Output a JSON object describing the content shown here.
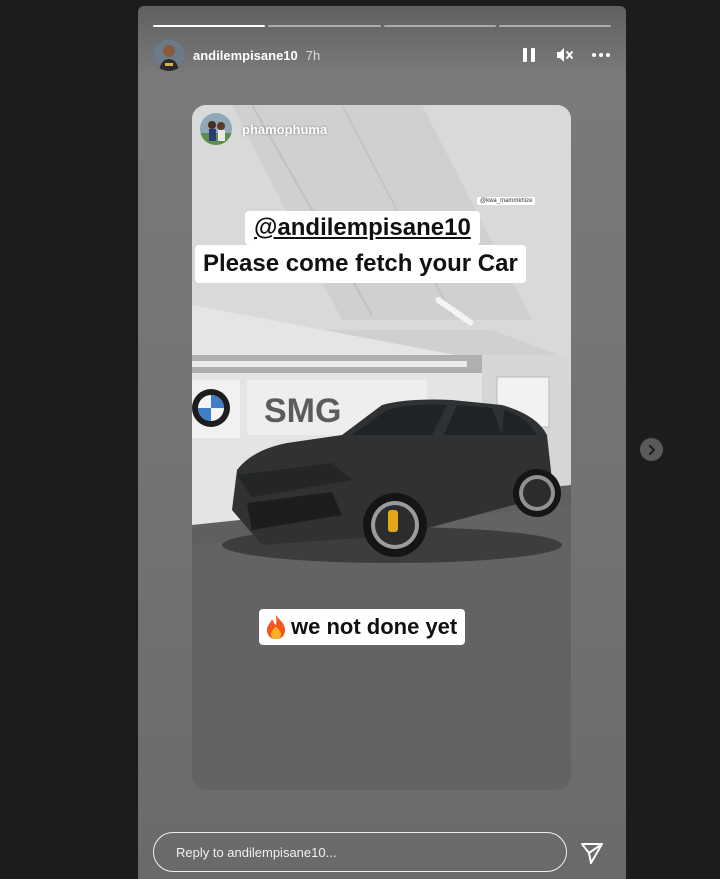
{
  "story": {
    "progress": [
      1,
      0,
      0,
      0
    ],
    "author": {
      "username": "andilempisane10",
      "time_ago": "7h"
    },
    "controls": {
      "pause_icon": "pause-icon",
      "mute_icon": "speaker-muted-icon",
      "more_icon": "more-horizontal-icon"
    },
    "shared_post": {
      "username": "phamophuma",
      "small_tag": "@kwa_mammkhize",
      "mention": "@andilempisane10",
      "caption": "Please come fetch your Car",
      "emoji": "fire-emoji",
      "caption2": "we not done yet",
      "wall_sign": "SMG"
    },
    "reply": {
      "placeholder": "Reply to andilempisane10..."
    },
    "send_icon": "send-icon",
    "next_icon": "chevron-right-icon"
  },
  "colors": {
    "page_background": "#1c1c1c",
    "story_background": "#727272",
    "text": "#ffffff"
  }
}
